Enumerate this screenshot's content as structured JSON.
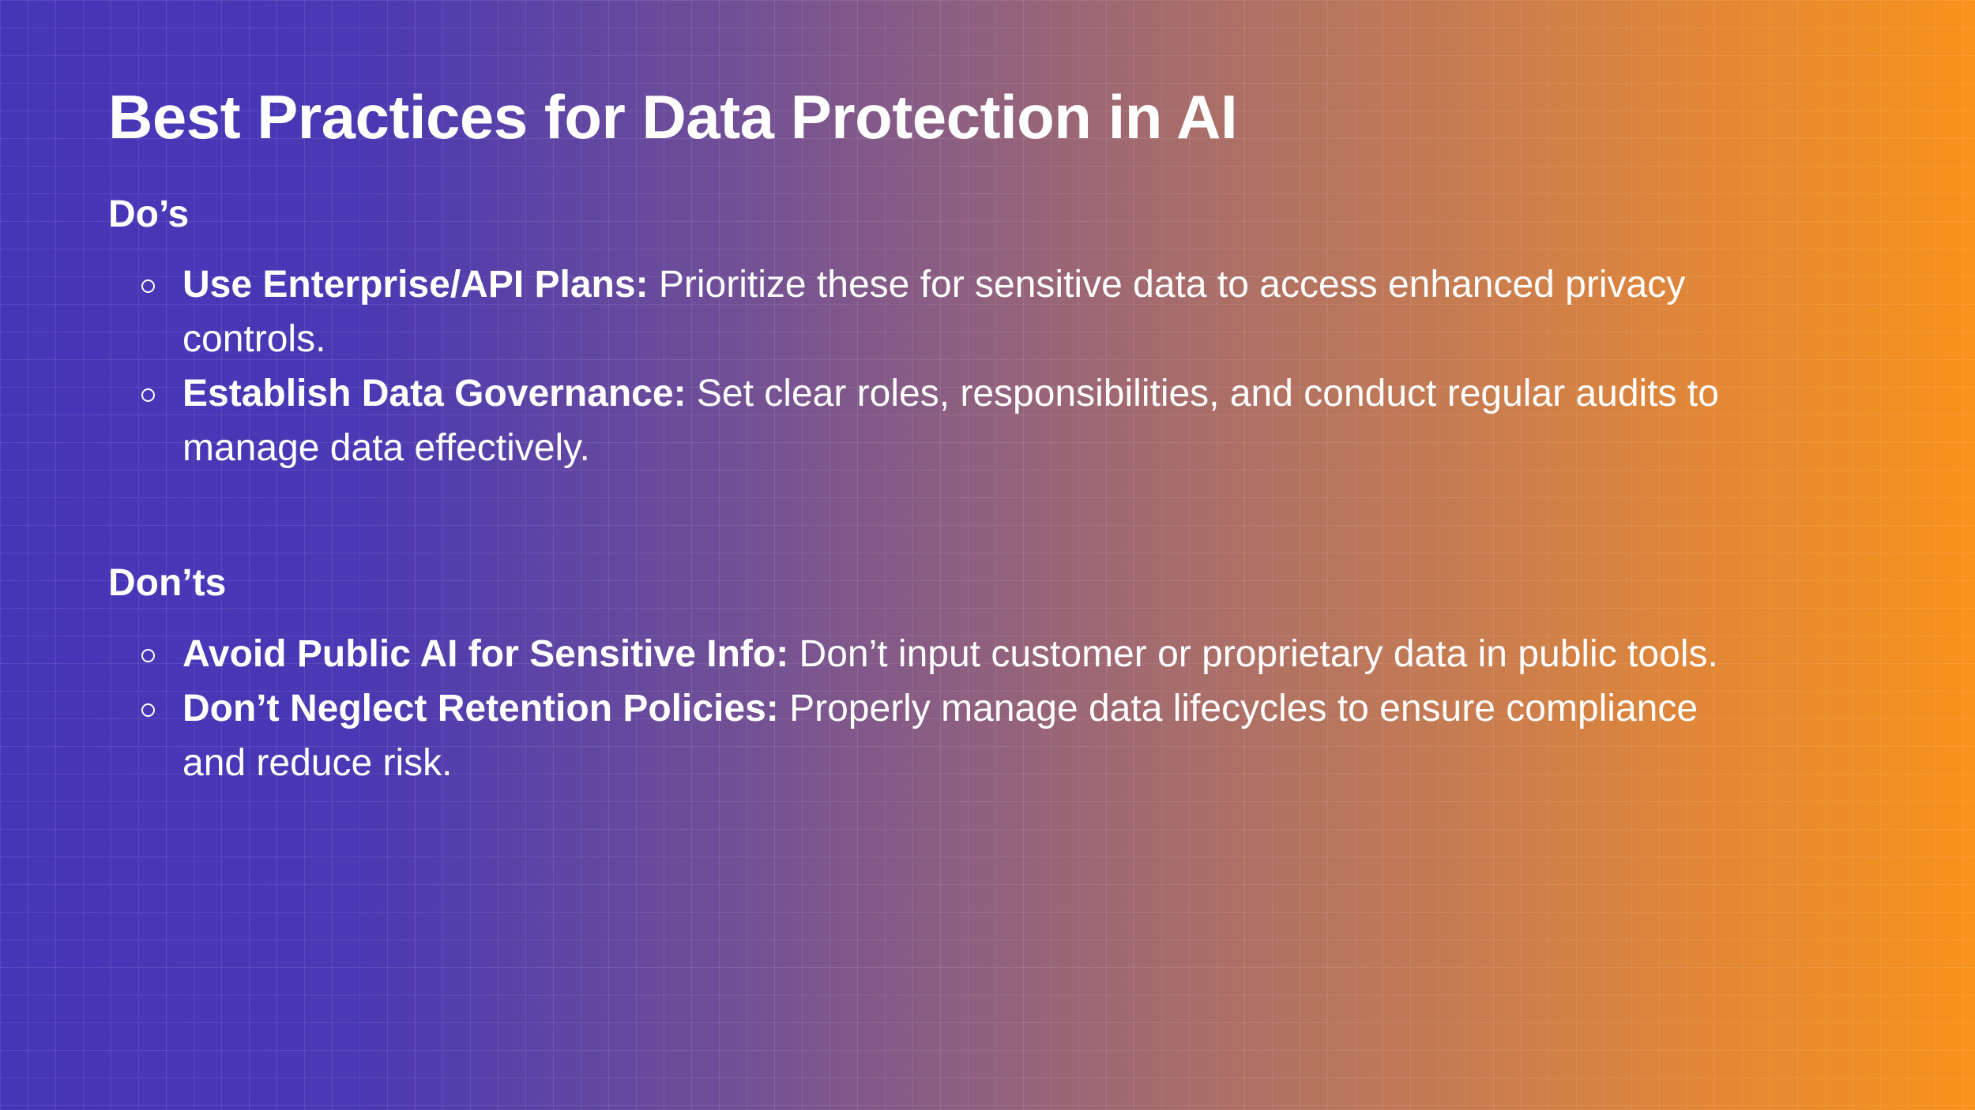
{
  "slide": {
    "title": "Best Practices for Data Protection in AI",
    "sections": [
      {
        "heading": "Do’s",
        "items": [
          {
            "lead": "Use Enterprise/API Plans:",
            "text": "Prioritize these for sensitive data to access enhanced privacy controls."
          },
          {
            "lead": "Establish Data Governance:",
            "text": "Set clear roles, responsibilities, and conduct regular audits to manage data effectively."
          }
        ]
      },
      {
        "heading": "Don’ts",
        "items": [
          {
            "lead": "Avoid Public AI for Sensitive Info:",
            "text": "Don’t input customer or proprietary data in public tools."
          },
          {
            "lead": "Don’t Neglect Retention Policies:",
            "text": "Properly manage data lifecycles to ensure compliance and reduce risk."
          }
        ]
      }
    ]
  },
  "colors": {
    "gradient_start": "#4536b8",
    "gradient_end": "#f8921c",
    "text": "#ffffff"
  }
}
